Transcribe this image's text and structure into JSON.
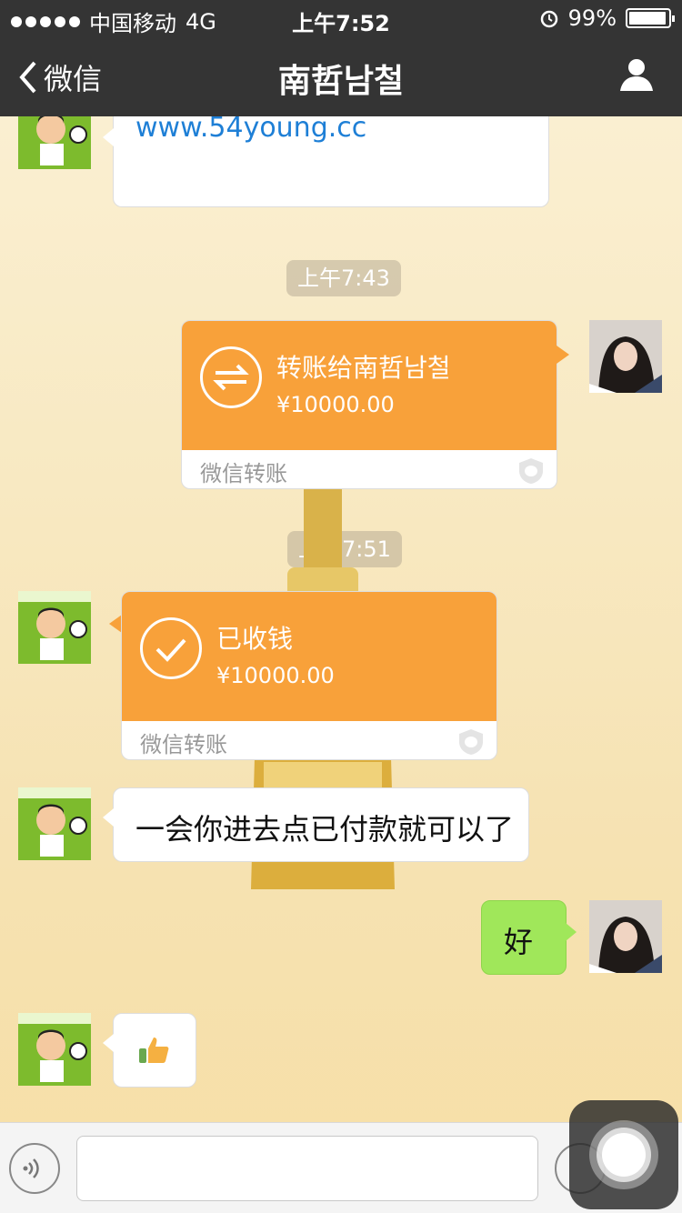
{
  "status_bar": {
    "carrier": "中国移动",
    "network": "4G",
    "time": "上午7:52",
    "battery": "99%",
    "battery_level": 0.99
  },
  "nav": {
    "back_label": "微信",
    "title": "南哲남철"
  },
  "messages": {
    "m1": {
      "sender": "contact",
      "text": "www.54young.cc"
    },
    "ts1": "上午7:43",
    "m2": {
      "sender": "me",
      "title": "转账给南哲남철",
      "amount": "¥10000.00",
      "footer": "微信转账"
    },
    "ts2": "上午7:51",
    "m3": {
      "sender": "contact",
      "title": "已收钱",
      "amount": "¥10000.00",
      "footer": "微信转账"
    },
    "m4": {
      "sender": "contact",
      "text": "一会你进去点已付款就可以了"
    },
    "m5": {
      "sender": "me",
      "text": "好"
    },
    "m6": {
      "sender": "contact",
      "emoji": "thumbs-up-icon"
    }
  },
  "colors": {
    "nav_bg": "#343434",
    "transfer_orange": "#f8a13a",
    "my_bubble_green": "#a0e75a",
    "link_blue": "#1e7fd6"
  }
}
